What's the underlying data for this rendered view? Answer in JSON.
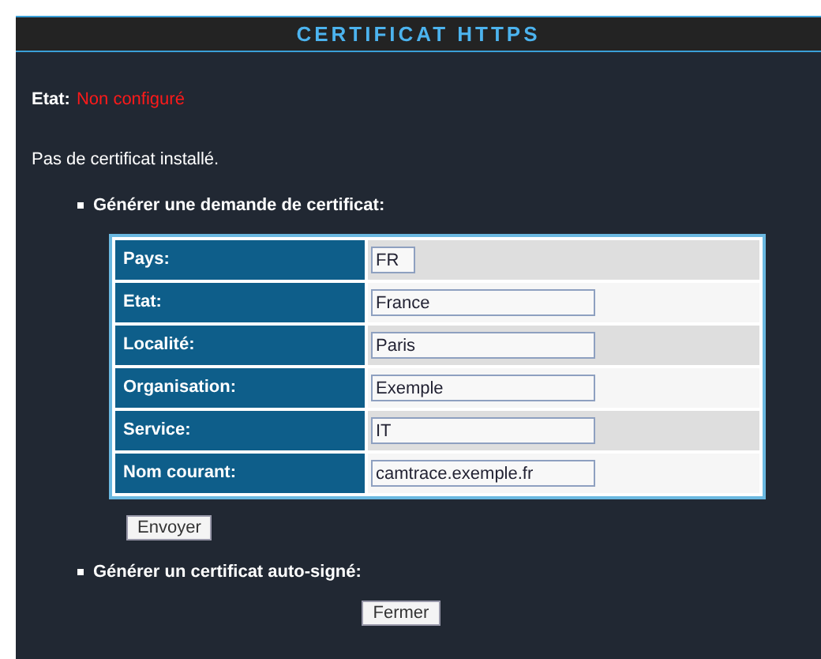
{
  "title": "CERTIFICAT HTTPS",
  "status": {
    "label": "Etat:",
    "value": "Non configuré"
  },
  "message": "Pas de certificat installé.",
  "request_section": {
    "heading": "Générer une demande de certificat:",
    "fields": [
      {
        "label": "Pays:",
        "value": "FR",
        "kind": "short"
      },
      {
        "label": "Etat:",
        "value": "France",
        "kind": "long"
      },
      {
        "label": "Localité:",
        "value": "Paris",
        "kind": "long"
      },
      {
        "label": "Organisation:",
        "value": "Exemple",
        "kind": "long"
      },
      {
        "label": "Service:",
        "value": "IT",
        "kind": "long"
      },
      {
        "label": "Nom courant:",
        "value": "camtrace.exemple.fr",
        "kind": "long"
      }
    ],
    "submit": "Envoyer"
  },
  "self_signed_section": {
    "heading": "Générer un certificat auto-signé:"
  },
  "close_button": "Fermer"
}
